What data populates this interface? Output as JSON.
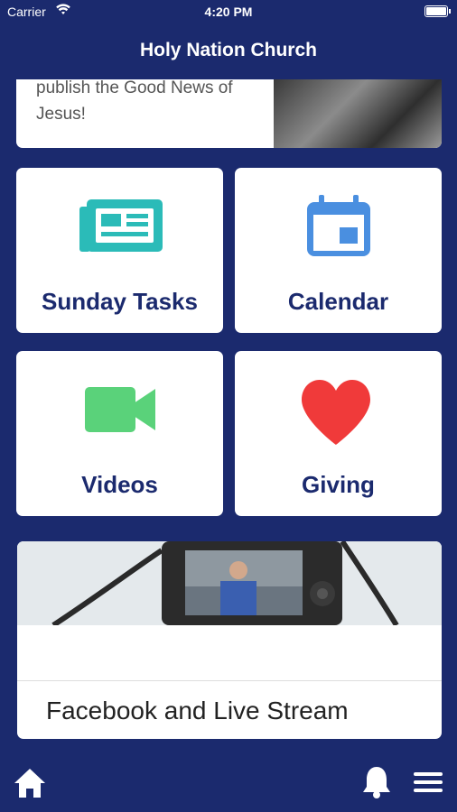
{
  "status_bar": {
    "carrier": "Carrier",
    "time": "4:20 PM"
  },
  "header": {
    "title": "Holy Nation Church"
  },
  "promo": {
    "text": "publish the Good News of Jesus!"
  },
  "tiles": [
    {
      "label": "Sunday Tasks",
      "icon": "newspaper-icon",
      "color": "#2bbbb8"
    },
    {
      "label": "Calendar",
      "icon": "calendar-icon",
      "color": "#4a8fe0"
    },
    {
      "label": "Videos",
      "icon": "video-camera-icon",
      "color": "#5ad27a"
    },
    {
      "label": "Giving",
      "icon": "heart-icon",
      "color": "#f03a3a"
    }
  ],
  "live_stream": {
    "label": "Facebook and Live Stream"
  },
  "bottom_bar": {
    "home_icon": "home-icon",
    "notifications_icon": "bell-icon",
    "menu_icon": "menu-icon"
  },
  "colors": {
    "background": "#1b2a6e",
    "tile_label": "#1b2a6e"
  }
}
